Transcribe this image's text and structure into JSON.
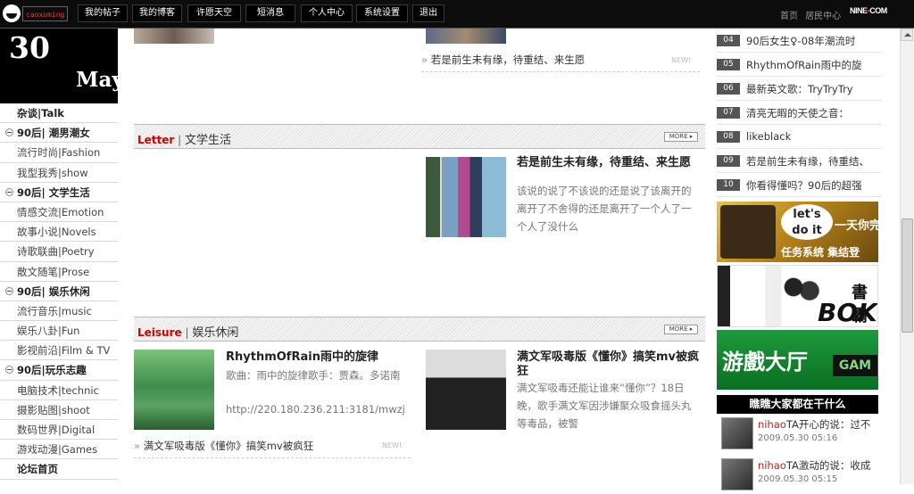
{
  "topbar": {
    "username": "caoxuming",
    "nav_buttons": [
      "我的帖子",
      "我的博客",
      "许愿天空",
      "短消息",
      "个人中心",
      "系统设置",
      "退出"
    ],
    "right_links": [
      "首页",
      "居民中心"
    ],
    "brand": "NINE",
    "brand_suffix": "COM"
  },
  "date": {
    "day": "30",
    "month": "May"
  },
  "sidebar": {
    "items": [
      {
        "label": "杂谈|Talk",
        "type": "top"
      },
      {
        "label": "90后| 潮男潮女",
        "type": "cat"
      },
      {
        "label": "流行时尚|Fashion",
        "type": "sub"
      },
      {
        "label": "我型我秀|show",
        "type": "sub"
      },
      {
        "label": "90后| 文学生活",
        "type": "cat"
      },
      {
        "label": "情感交流|Emotion",
        "type": "sub"
      },
      {
        "label": "故事小说|Novels",
        "type": "sub"
      },
      {
        "label": "诗歌联曲|Poetry",
        "type": "sub"
      },
      {
        "label": "散文随笔|Prose",
        "type": "sub"
      },
      {
        "label": "90后| 娱乐休闲",
        "type": "cat"
      },
      {
        "label": "流行音乐|music",
        "type": "sub"
      },
      {
        "label": "娱乐八卦|Fun",
        "type": "sub"
      },
      {
        "label": "影视前沿|Film & TV",
        "type": "sub"
      },
      {
        "label": "90后|玩乐志趣",
        "type": "cat"
      },
      {
        "label": "电脑技术|technic",
        "type": "sub"
      },
      {
        "label": "摄影贴图|shoot",
        "type": "sub"
      },
      {
        "label": "数码世界|Digital",
        "type": "sub"
      },
      {
        "label": "游戏动漫|Games",
        "type": "sub"
      },
      {
        "label": "论坛首页",
        "type": "top"
      }
    ]
  },
  "top_link": {
    "text": "若是前生未有缘，待重结、来生愿",
    "new": "NEW!"
  },
  "letter": {
    "en": "Letter",
    "sep": " | ",
    "cn": "文学生活",
    "more": "MORE ▸",
    "post_title": "若是前生未有缘，待重结、来生愿",
    "post_desc": "该说的说了不该说的还是说了该离开的离开了不舍得的还是离开了一个人了一个人了没什么"
  },
  "leisure": {
    "en": "Leisure",
    "sep": " | ",
    "cn": "娱乐休闲",
    "more": "MORE ▸",
    "post1_title": "RhythmOfRain雨中的旋律",
    "post1_desc": "歌曲：雨中的旋律歌手：贾森。多诺南",
    "post1_url": "http://220.180.236.211:3181/mwzj/a",
    "post1_link": "满文军吸毒版《懂你》搞笑mv被疯狂",
    "post1_new": "NEW!",
    "post2_title": "满文军吸毒版《懂你》搞笑mv被疯狂",
    "post2_desc": "满文军吸毒还能让谁来“懂你”？18日晚，歌手满文军因涉嫌聚众吸食摇头丸等毒品，被警"
  },
  "ranking": [
    {
      "num": "04",
      "text": "90后女生♀-08年潮流时"
    },
    {
      "num": "05",
      "text": "RhythmOfRain雨中的旋"
    },
    {
      "num": "06",
      "text": "最新英文歌：TryTryTry"
    },
    {
      "num": "07",
      "text": "清亮无暇的天使之音："
    },
    {
      "num": "08",
      "text": "likeblack"
    },
    {
      "num": "09",
      "text": "若是前生未有缘，待重结、"
    },
    {
      "num": "10",
      "text": "你看得懂吗？90后的超强"
    }
  ],
  "banners": {
    "b1_text1": "let's",
    "b1_text2": "do it",
    "b1_text3": "一天你完",
    "b1_text4": "任务系统 集结登",
    "b2_text1": "書霸",
    "b2_text2": "BOK",
    "b3_text1": "游戲大厅",
    "b3_text2": "GAM"
  },
  "whatsup": {
    "title": "瞧瞧大家都在干什么",
    "feed": [
      {
        "user": "nihao",
        "action": "TA开心的说：过不",
        "time": "2009.05.30 05:16"
      },
      {
        "user": "nihao",
        "action": "TA激动的说：收成",
        "time": "2009.05.30 05:15"
      }
    ]
  },
  "colors": {
    "accent": "#cc0000",
    "topbar": "#0c0c0c"
  }
}
